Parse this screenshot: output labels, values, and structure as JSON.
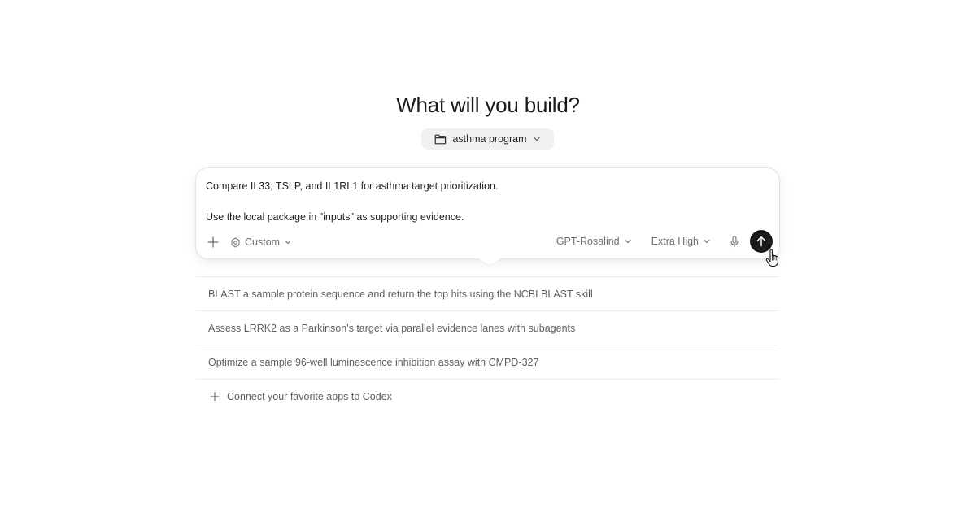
{
  "heading": "What will you build?",
  "project": {
    "icon": "folder-icon",
    "label": "asthma program"
  },
  "composer": {
    "prompt_line1": "Compare IL33, TSLP, and IL1RL1 for asthma target prioritization.",
    "prompt_line2": "Use the local package in \"inputs\" as supporting evidence.",
    "mode_label": "Custom",
    "model_label": "GPT-Rosalind",
    "effort_label": "Extra High"
  },
  "suggestions": [
    "BLAST a sample protein sequence and return the top hits using the NCBI BLAST skill",
    "Assess LRRK2 as a Parkinson's target via parallel evidence lanes with subagents",
    "Optimize a sample 96-well luminescence inhibition assay with CMPD-327"
  ],
  "connect_apps_label": "Connect your favorite apps to Codex",
  "colors": {
    "send_button": "#1a1a1a",
    "chip_background": "#f1f1f1",
    "muted_text": "#6f6f6f"
  }
}
